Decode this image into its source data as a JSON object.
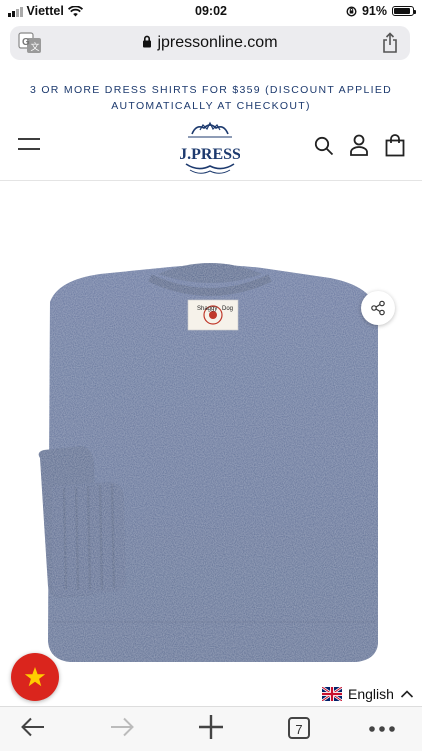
{
  "status_bar": {
    "carrier": "Viettel",
    "time": "09:02",
    "battery": "91%",
    "battery_level": 0.91
  },
  "browser": {
    "url": "jpressonline.com",
    "tabs_count": "7"
  },
  "promo": {
    "text": "3 OR MORE DRESS SHIRTS FOR $359 (DISCOUNT APPLIED AUTOMATICALLY AT CHECKOUT)"
  },
  "header": {
    "logo_text": "J.PRESS"
  },
  "product": {
    "label_text_left": "Shaggy",
    "label_text_right": "Dog",
    "sweater_color": "#5a6d99"
  },
  "language": {
    "label": "English"
  },
  "colors": {
    "brand_navy": "#1d3a6e",
    "vietnam_red": "#da251d",
    "star_yellow": "#ffcd00"
  }
}
